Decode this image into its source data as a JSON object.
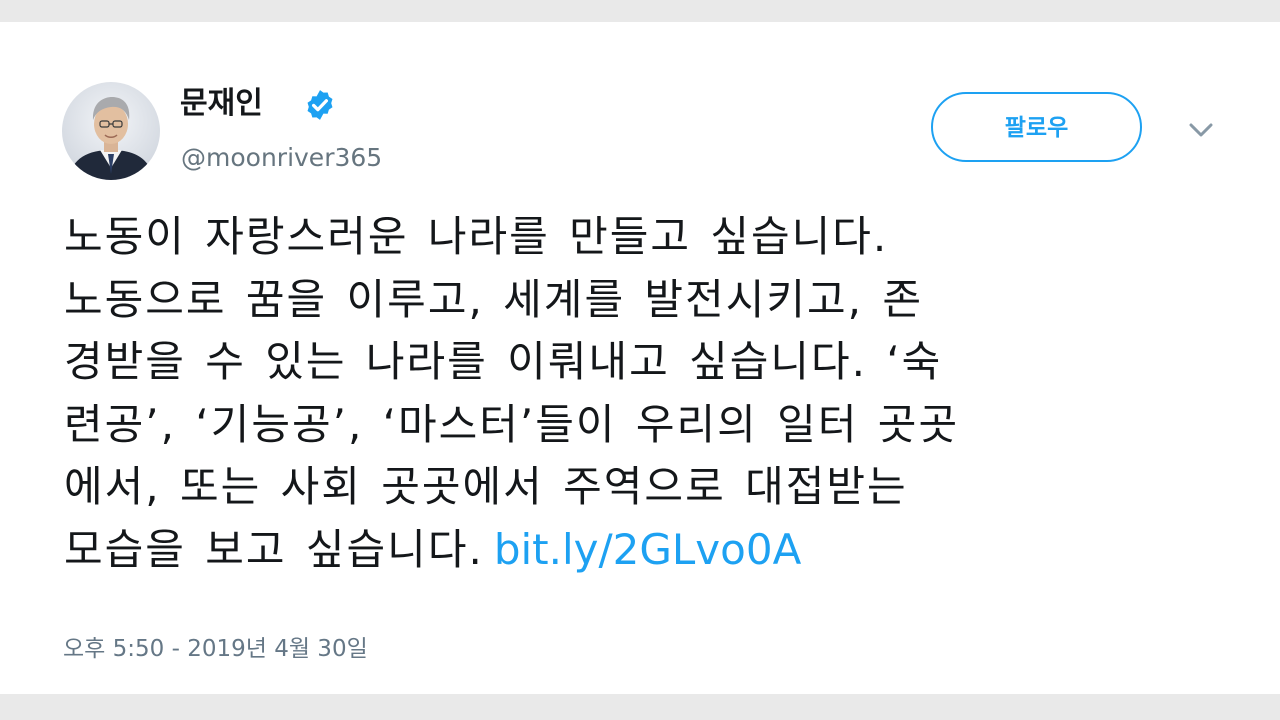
{
  "user": {
    "display_name": "문재인",
    "handle": "@moonriver365",
    "verified": true
  },
  "follow_button": {
    "label": "팔로우"
  },
  "menu": {
    "icon": "chevron-down-icon"
  },
  "tweet": {
    "lines": [
      "노동이 자랑스러운 나라를 만들고 싶습니다.",
      "노동으로 꿈을 이루고, 세계를 발전시키고, 존",
      "경받을 수 있는 나라를 이뤄내고 싶습니다. ‘숙",
      "련공’, ‘기능공’, ‘마스터’들이 우리의 일터 곳곳",
      "에서, 또는 사회 곳곳에서 주역으로 대접받는",
      "모습을 보고 싶습니다."
    ],
    "link": "bit.ly/2GLvo0A",
    "timestamp": "오후 5:50 - 2019년 4월 30일"
  },
  "colors": {
    "accent": "#1da1f2",
    "text": "#14171a",
    "secondary_text": "#66757f",
    "background": "#ffffff",
    "frame": "#e9e9e9"
  }
}
